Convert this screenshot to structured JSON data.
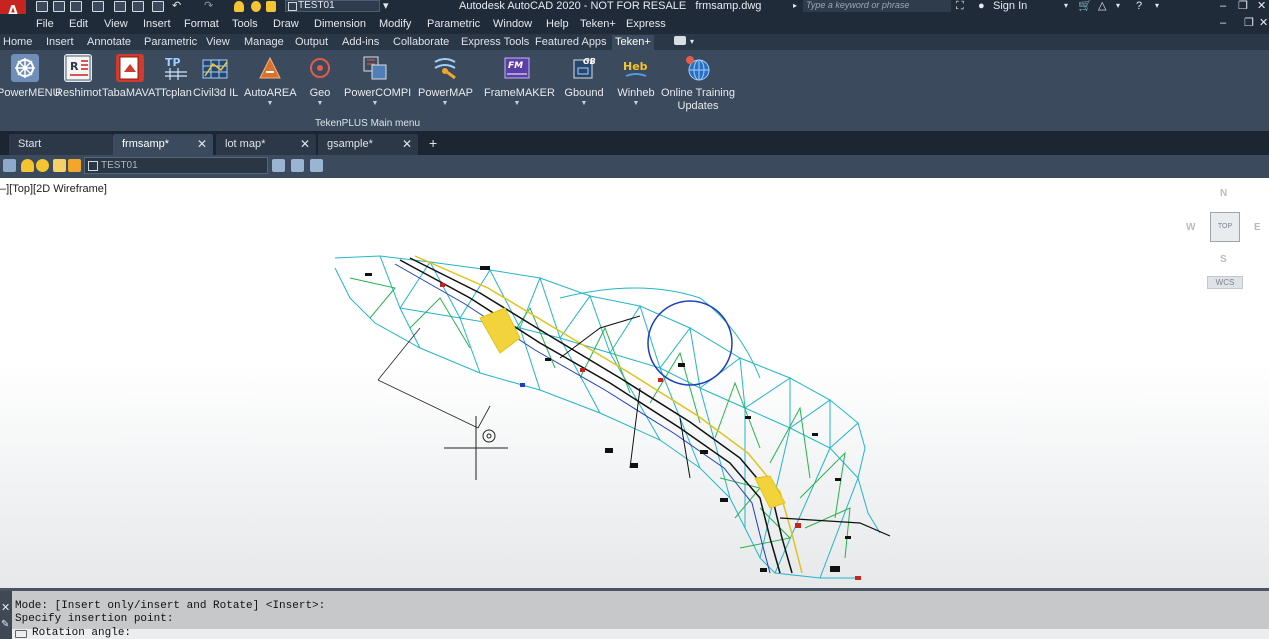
{
  "titlebar": {
    "app_title": "Autodesk AutoCAD 2020 - NOT FOR RESALE",
    "file_name": "frmsamp.dwg",
    "layer_value": "TEST01",
    "search_placeholder": "Type a keyword or phrase",
    "sign_in": "Sign In",
    "app_logo": "A"
  },
  "menu": {
    "items": [
      "File",
      "Edit",
      "View",
      "Insert",
      "Format",
      "Tools",
      "Draw",
      "Dimension",
      "Modify",
      "Parametric",
      "Window",
      "Help",
      "Teken+",
      "Express"
    ]
  },
  "ribbon_tabs": {
    "items": [
      "Home",
      "Insert",
      "Annotate",
      "Parametric",
      "View",
      "Manage",
      "Output",
      "Add-ins",
      "Collaborate",
      "Express Tools",
      "Featured Apps",
      "Teken+"
    ],
    "active": "Teken+"
  },
  "ribbon": {
    "tools": [
      {
        "label": "PowerMENU",
        "icon": "powermenu-icon",
        "dropdown": false
      },
      {
        "label": "Reshimot",
        "icon": "reshimot-icon",
        "dropdown": false
      },
      {
        "label": "TabaMAVAT",
        "icon": "tabamavat-icon",
        "dropdown": false
      },
      {
        "label": "Tcplan",
        "icon": "tcplan-icon",
        "dropdown": false
      },
      {
        "label": "Civil3d IL",
        "icon": "civil3d-icon",
        "dropdown": false
      },
      {
        "label": "AutoAREA",
        "icon": "autoarea-icon",
        "dropdown": true
      },
      {
        "label": "Geo",
        "icon": "geo-icon",
        "dropdown": true
      },
      {
        "label": "PowerCOMPI",
        "icon": "powercompi-icon",
        "dropdown": true
      },
      {
        "label": "PowerMAP",
        "icon": "powermap-icon",
        "dropdown": true
      },
      {
        "label": "FrameMAKER",
        "icon": "framemaker-icon",
        "dropdown": true
      },
      {
        "label": "Gbound",
        "icon": "gbound-icon",
        "dropdown": true
      },
      {
        "label": "Winheb",
        "icon": "winheb-icon",
        "dropdown": true
      },
      {
        "label": "Online Training",
        "label2": "Updates",
        "icon": "globe-icon",
        "dropdown": false
      }
    ],
    "panel_title": "TekenPLUS Main menu",
    "icon_glyphs": {
      "reshimot": "R",
      "tcplan": "TP",
      "framemaker": "FM",
      "gbound": "GB",
      "winheb": "Heb"
    }
  },
  "file_tabs": {
    "items": [
      {
        "label": "Start",
        "closable": false,
        "active": false
      },
      {
        "label": "frmsamp*",
        "closable": true,
        "active": true
      },
      {
        "label": "lot map*",
        "closable": true,
        "active": false
      },
      {
        "label": "gsample*",
        "closable": true,
        "active": false
      }
    ],
    "add_symbol": "+",
    "close_symbol": "✕"
  },
  "layer_toolbar": {
    "layer_value": "TEST01"
  },
  "viewport": {
    "label": "–][Top][2D Wireframe]"
  },
  "viewcube": {
    "north": "N",
    "south": "S",
    "east": "E",
    "west": "W",
    "face": "TOP",
    "wcs": "WCS"
  },
  "command_line": {
    "lines": [
      "Mode: [Insert only/insert and Rotate] <Insert>:",
      "Specify insertion point:"
    ],
    "prompt": "Rotation angle:"
  },
  "colors": {
    "accent_red": "#c8241f",
    "drawing_cyan": "#23b5c9",
    "drawing_green": "#27b34a",
    "drawing_blue": "#1e3fbf"
  }
}
